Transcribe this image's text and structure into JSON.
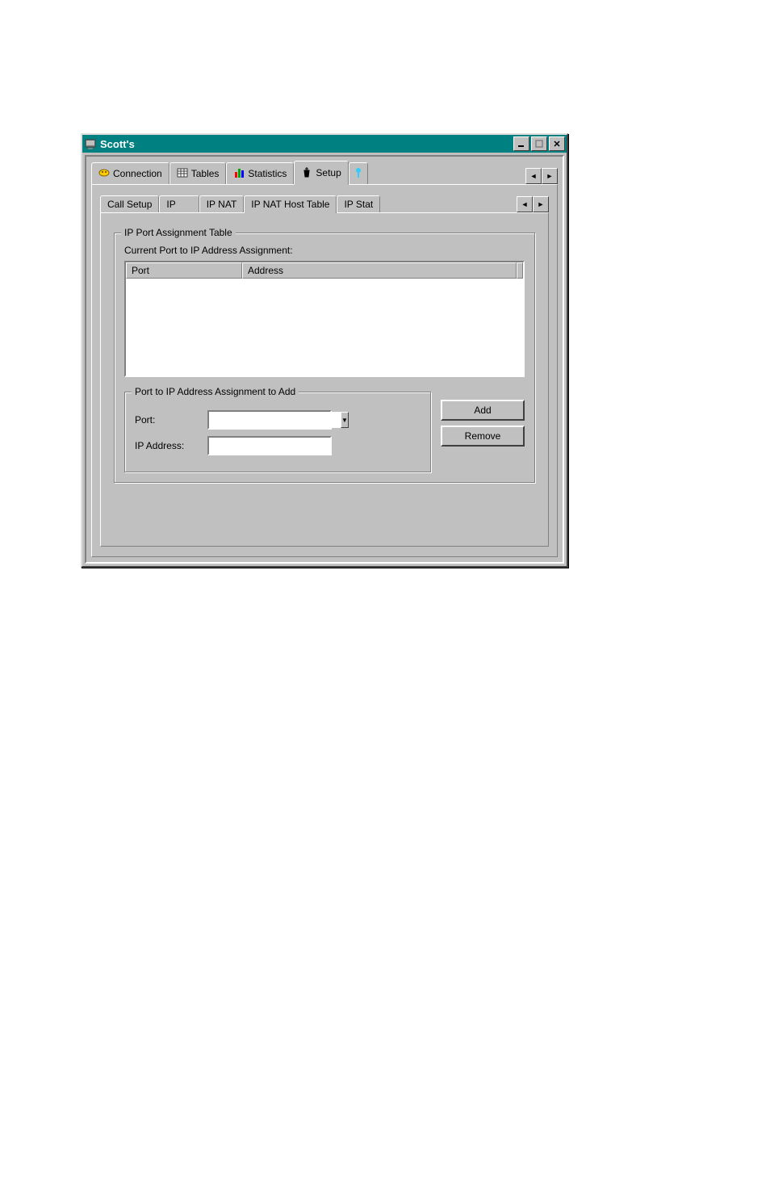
{
  "window": {
    "title": "Scott's"
  },
  "mainTabs": {
    "items": [
      {
        "label": "Connection"
      },
      {
        "label": "Tables"
      },
      {
        "label": "Statistics"
      },
      {
        "label": "Setup"
      }
    ]
  },
  "subTabs": {
    "items": [
      {
        "label": "Call Setup"
      },
      {
        "label": "IP"
      },
      {
        "label": "IP NAT"
      },
      {
        "label": "IP NAT Host Table"
      },
      {
        "label": "IP Stat"
      }
    ]
  },
  "groupbox1": {
    "title": "IP Port Assignment Table",
    "subtitle": "Current Port to IP Address Assignment:",
    "columns": {
      "port": "Port",
      "address": "Address"
    }
  },
  "groupbox2": {
    "title": "Port to IP Address Assignment to Add",
    "portLabel": "Port:",
    "ipLabel": "IP Address:",
    "portValue": "",
    "ipValue": ""
  },
  "buttons": {
    "add": "Add",
    "remove": "Remove"
  }
}
